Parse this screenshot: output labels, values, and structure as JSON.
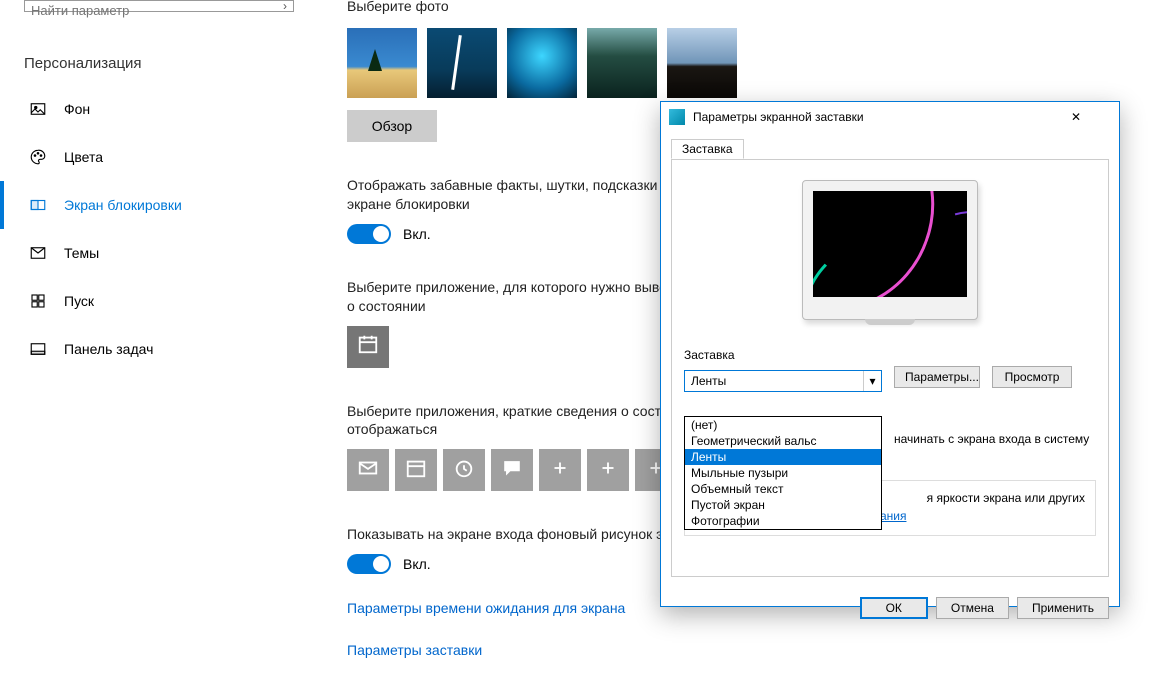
{
  "search": {
    "placeholder": "Найти параметр"
  },
  "category_title": "Персонализация",
  "sidebar": {
    "items": [
      {
        "label": "Фон"
      },
      {
        "label": "Цвета"
      },
      {
        "label": "Экран блокировки"
      },
      {
        "label": "Темы"
      },
      {
        "label": "Пуск"
      },
      {
        "label": "Панель задач"
      }
    ]
  },
  "main": {
    "photo_label": "Выберите фото",
    "browse": "Обзор",
    "fun_facts": "Отображать забавные факты, шутки, подсказки и другую информацию на экране блокировки",
    "on": "Вкл.",
    "detailed_app": "Выберите приложение, для которого нужно выводить подробные сведения о состоянии",
    "quick_apps": "Выберите приложения, краткие сведения о состоянии которых будут отображаться",
    "show_bg": "Показывать на экране входа фоновый рисунок экрана блокировки",
    "link_timeout": "Параметры времени ожидания для экрана",
    "link_saver": "Параметры заставки"
  },
  "dialog": {
    "title": "Параметры экранной заставки",
    "tab": "Заставка",
    "group_label": "Заставка",
    "combo_value": "Ленты",
    "options": [
      "(нет)",
      "Геометрический вальс",
      "Ленты",
      "Мыльные пузыри",
      "Объемный текст",
      "Пустой экран",
      "Фотографии"
    ],
    "btn_params": "Параметры...",
    "btn_preview": "Просмотр",
    "resume_text": "начинать с экрана входа в систему",
    "energy_text": "Энергосбережение: настройка яркости экрана или других параметров электропитания",
    "energy_visible": "я яркости экрана или других",
    "energy_link": "Изменить параметры электропитания",
    "ok": "ОК",
    "cancel": "Отмена",
    "apply": "Применить"
  }
}
